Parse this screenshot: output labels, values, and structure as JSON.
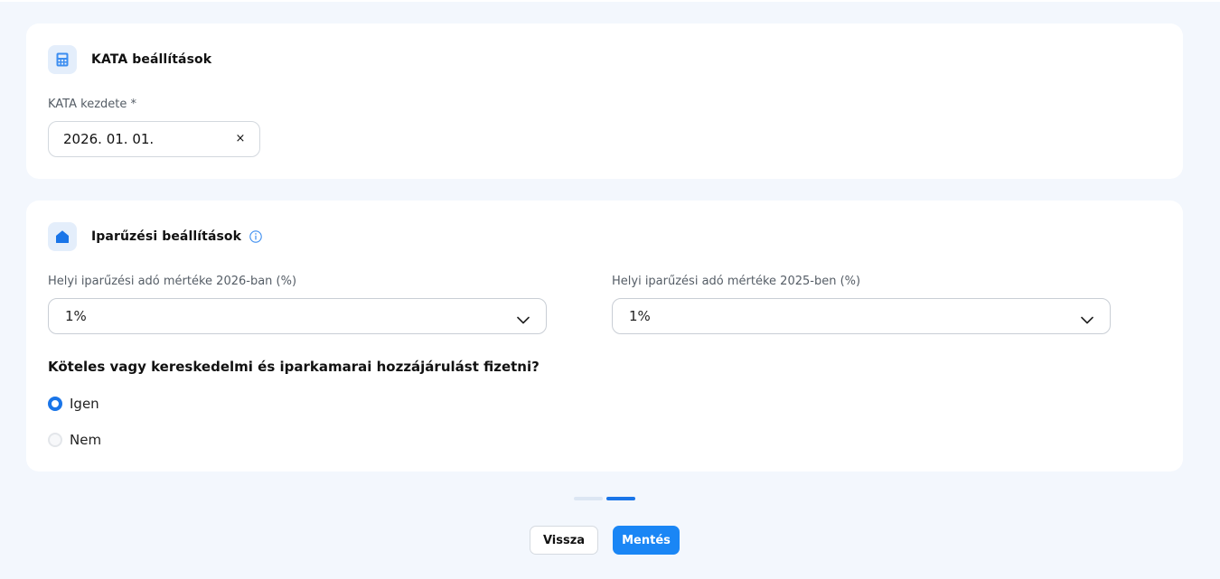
{
  "kata": {
    "title": "KATA beállítások",
    "icon": "calculator-icon",
    "start_label": "KATA kezdete *",
    "start_value": "2026. 01. 01.",
    "clear_symbol": "×"
  },
  "iparuzesi": {
    "title": "Iparűzési beállítások",
    "icon": "home-icon",
    "rate_2026_label": "Helyi iparűzési adó mértéke 2026-ban (%)",
    "rate_2026_value": "1%",
    "rate_2025_label": "Helyi iparűzési adó mértéke 2025-ben (%)",
    "rate_2025_value": "1%",
    "question": "Köteles vagy kereskedelmi és iparkamarai hozzájárulást fizetni?",
    "options": [
      {
        "label": "Igen",
        "selected": true
      },
      {
        "label": "Nem",
        "selected": false
      }
    ]
  },
  "stepper": {
    "total": 2,
    "current": 2
  },
  "actions": {
    "back_label": "Vissza",
    "save_label": "Mentés"
  },
  "colors": {
    "accent": "#1a75e8",
    "button": "#1a86f5",
    "background": "#f3f7fd"
  }
}
